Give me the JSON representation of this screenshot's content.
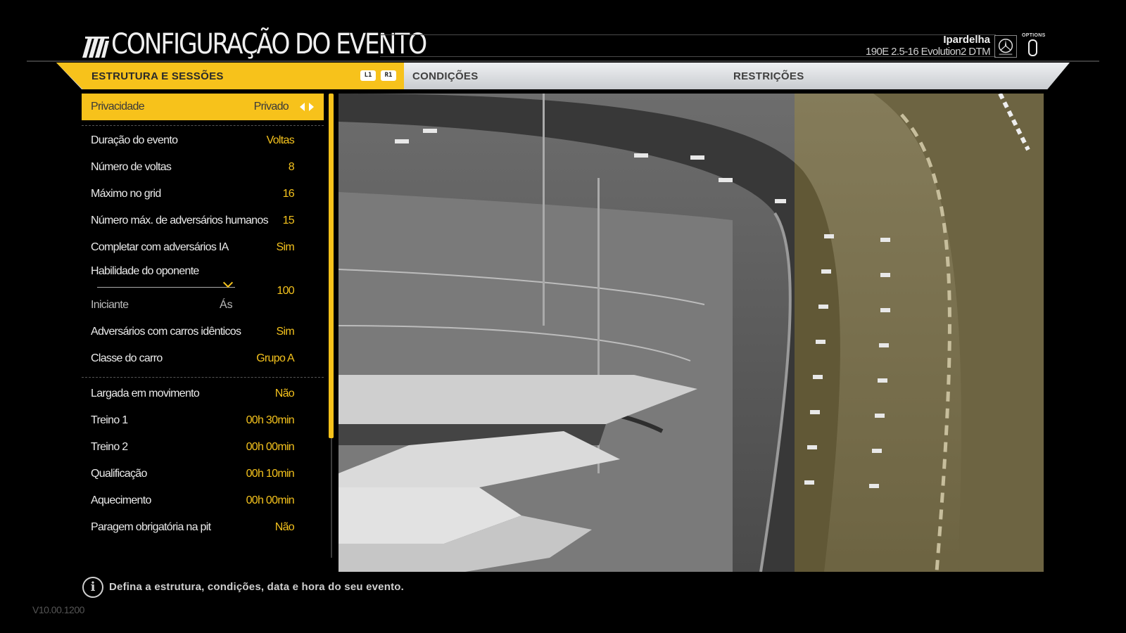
{
  "header": {
    "title": "CONFIGURAÇÃO DO EVENTO",
    "profile_name": "Ipardelha",
    "car": "190E 2.5-16 Evolution2 DTM",
    "options_label": "OPTIONS"
  },
  "tabs": {
    "structure": "ESTRUTURA E SESSÕES",
    "conditions": "CONDIÇÕES",
    "restrictions": "RESTRIÇÕES",
    "l1": "L1",
    "r1": "R1"
  },
  "settings": {
    "privacy": {
      "label": "Privacidade",
      "value": "Privado"
    },
    "duration": {
      "label": "Duração do evento",
      "value": "Voltas"
    },
    "laps": {
      "label": "Número de voltas",
      "value": "8"
    },
    "grid_max": {
      "label": "Máximo no grid",
      "value": "16"
    },
    "human_max": {
      "label": "Número máx. de adversários humanos",
      "value": "15"
    },
    "fill_ai": {
      "label": "Completar com adversários IA",
      "value": "Sim"
    },
    "skill": {
      "label": "Habilidade do oponente",
      "min": "Iniciante",
      "max": "Ás",
      "value": "100"
    },
    "identical_cars": {
      "label": "Adversários com carros idênticos",
      "value": "Sim"
    },
    "car_class": {
      "label": "Classe do carro",
      "value": "Grupo A"
    },
    "rolling_start": {
      "label": "Largada em movimento",
      "value": "Não"
    },
    "practice1": {
      "label": "Treino 1",
      "value": "00h 30min"
    },
    "practice2": {
      "label": "Treino 2",
      "value": "00h 00min"
    },
    "qualifying": {
      "label": "Qualificação",
      "value": "00h 10min"
    },
    "warmup": {
      "label": "Aquecimento",
      "value": "00h 00min"
    },
    "pit_stop": {
      "label": "Paragem obrigatória na pit",
      "value": "Não"
    }
  },
  "footer": {
    "info": "Defina a estrutura, condições, data e hora do seu evento.",
    "version": "V10.00.1200"
  },
  "colors": {
    "accent": "#f7c21b",
    "value_text": "#f4c21d",
    "tab_bar": "#d9dcdf",
    "background": "#000000"
  },
  "icons": {
    "logo": "project-cars-stripes-icon",
    "brand": "mercedes-star-icon",
    "options": "options-button-icon",
    "info": "info-icon"
  }
}
